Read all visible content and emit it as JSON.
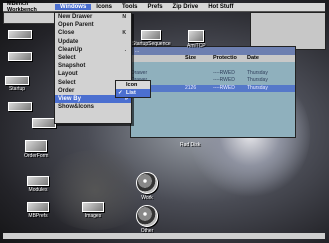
{
  "screen": {
    "title": "MBench Workbench",
    "menus": [
      "MBench",
      "Windows",
      "Icons",
      "Tools",
      "Prefs",
      "Zip Drive",
      "Hot Stuff"
    ],
    "active_menu": "Windows"
  },
  "windows_menu": {
    "items": [
      {
        "label": "New Drawer",
        "shortcut": "N"
      },
      {
        "label": "Open Parent",
        "shortcut": ""
      },
      {
        "label": "Close",
        "shortcut": "K"
      },
      {
        "label": "Update",
        "shortcut": ""
      },
      {
        "label": "CleanUp",
        "shortcut": "."
      },
      {
        "label": "Select",
        "shortcut": ""
      },
      {
        "label": "Snapshot",
        "shortcut": ""
      },
      {
        "label": "Layout",
        "shortcut": ""
      },
      {
        "label": "Select",
        "shortcut": ""
      },
      {
        "label": "Order",
        "shortcut": ""
      },
      {
        "label": "View By",
        "shortcut": ""
      },
      {
        "label": "Show&Icons",
        "shortcut": ""
      }
    ],
    "selected_index": 10,
    "submenu_arrow": "»"
  },
  "view_by_submenu": {
    "items": [
      {
        "label": "Icon",
        "checked": false
      },
      {
        "label": "List",
        "checked": true
      }
    ],
    "highlighted_index": 1
  },
  "icons": [
    {
      "id": "startup-sequence",
      "label": "StartupSequence"
    },
    {
      "id": "amitcp",
      "label": "AmiTCP"
    },
    {
      "id": "startup",
      "label": "Startup"
    },
    {
      "id": "order-form",
      "label": "OrderForm"
    },
    {
      "id": "modules",
      "label": "Modules"
    },
    {
      "id": "mbprefs",
      "label": "MBPrefs"
    },
    {
      "id": "images",
      "label": "Images"
    },
    {
      "id": "work",
      "label": "Work"
    },
    {
      "id": "other",
      "label": "Other"
    },
    {
      "id": "rad-disk",
      "label": "Rad Disk"
    }
  ],
  "file_window": {
    "title": "...",
    "columns": [
      "Size",
      "Protectio",
      "Date"
    ],
    "rows": [
      {
        "name": "",
        "size": "",
        "prot": "",
        "date": ""
      },
      {
        "name": "Drawer",
        "size": "",
        "prot": "----RWED",
        "date": "Thursday"
      },
      {
        "name": "Drawer",
        "size": "",
        "prot": "----RWED",
        "date": "Thursday"
      },
      {
        "name": "",
        "size": "2126",
        "prot": "----RWED",
        "date": "Thursday"
      },
      {
        "name": "",
        "size": "",
        "prot": "",
        "date": ""
      },
      {
        "name": "",
        "size": "",
        "prot": "",
        "date": ""
      },
      {
        "name": "",
        "size": "",
        "prot": "",
        "date": ""
      },
      {
        "name": "",
        "size": "",
        "prot": "",
        "date": ""
      }
    ],
    "selected_row": 3
  },
  "colors": {
    "highlight": "#4b6fd0",
    "menu_bg": "#d2d2d2"
  }
}
